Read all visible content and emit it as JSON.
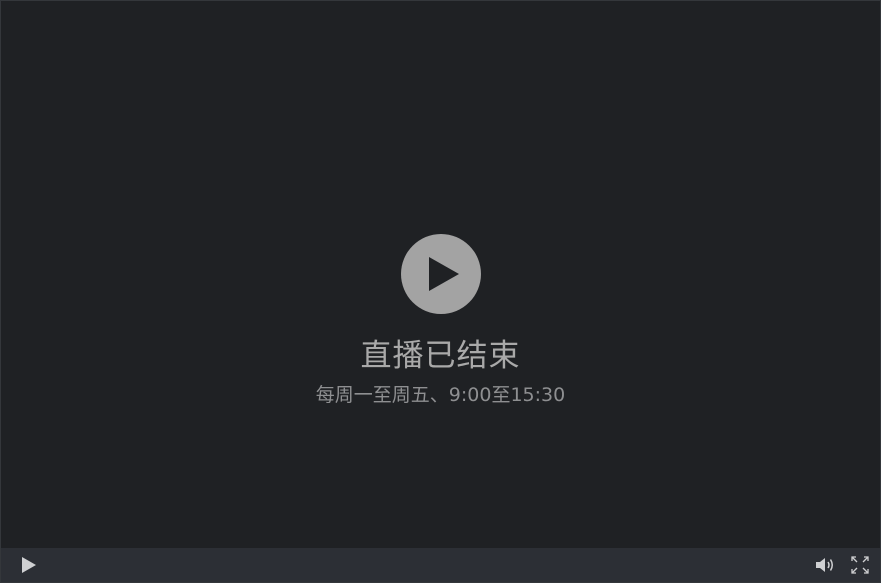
{
  "player": {
    "status": "直播已结束",
    "schedule": "每周一至周五、9:00至15:30"
  },
  "icons": {
    "center": "play-icon",
    "control_play": "play-icon",
    "volume": "volume-icon",
    "fullscreen": "fullscreen-icon"
  },
  "colors": {
    "background": "#1f2124",
    "control_bar": "#2c2f35",
    "play_circle": "#a3a3a3",
    "text_primary": "#a9a9a9",
    "text_secondary": "#8e8f91",
    "icon": "#cfd0d2"
  }
}
